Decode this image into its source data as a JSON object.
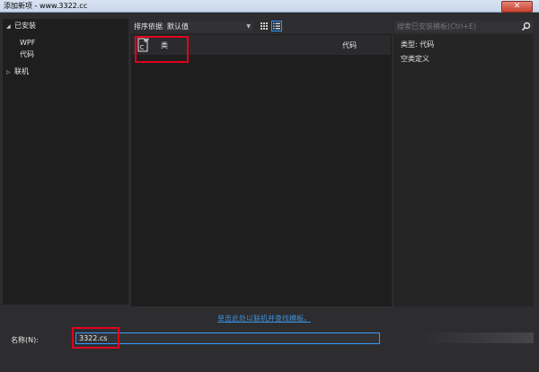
{
  "window": {
    "title": "添加新项 - www.3322.cc",
    "close_symbol": "✕"
  },
  "sidebar": {
    "installed": {
      "label": "已安装",
      "arrow": "◢"
    },
    "items": [
      {
        "label": "WPF"
      },
      {
        "label": "代码"
      }
    ],
    "online": {
      "label": "联机",
      "arrow": "▷"
    }
  },
  "toolbar": {
    "sort_label": "排序依据:",
    "sort_value": "默认值",
    "sort_chevron": "▼"
  },
  "search": {
    "placeholder": "搜索已安装模板(Ctrl+E)"
  },
  "templates": [
    {
      "name": "类",
      "language": "代码",
      "icon": "csharp-class-icon"
    }
  ],
  "details": {
    "type_line": "类型: 代码",
    "description": "空类定义"
  },
  "online_link": "单击此处以联机并查找模板。",
  "name_field": {
    "label": "名称(N):",
    "value": "3322.cs"
  },
  "colors": {
    "accent": "#3399ff",
    "highlight": "#e1001f",
    "link": "#3d8fd6",
    "background": "#2d2d30"
  }
}
